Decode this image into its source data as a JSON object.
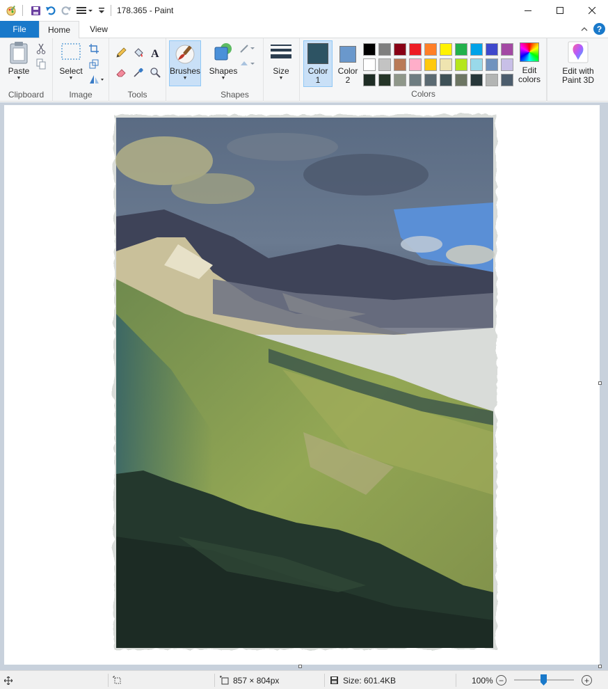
{
  "window": {
    "title": "178.365 - Paint"
  },
  "tabs": {
    "file": "File",
    "home": "Home",
    "view": "View"
  },
  "ribbon": {
    "clipboard": {
      "label": "Clipboard",
      "paste": "Paste"
    },
    "image": {
      "label": "Image",
      "select": "Select"
    },
    "tools": {
      "label": "Tools"
    },
    "brushes": {
      "label": "Brushes"
    },
    "shapes": {
      "label": "Shapes",
      "button": "Shapes"
    },
    "size": {
      "label": "Size"
    },
    "colors": {
      "label": "Colors",
      "color1_line1": "Color",
      "color1_line2": "1",
      "color2_line1": "Color",
      "color2_line2": "2",
      "edit_line1": "Edit",
      "edit_line2": "colors",
      "paint3d_line1": "Edit with",
      "paint3d_line2": "Paint 3D",
      "color1_value": "#2d5363",
      "color2_value": "#6a98cc",
      "palette": [
        "#000000",
        "#7f7f7f",
        "#880015",
        "#ed1c24",
        "#ff7f27",
        "#fff200",
        "#22b14c",
        "#00a2e8",
        "#3f48cc",
        "#a349a4",
        "#ffffff",
        "#c3c3c3",
        "#b97a57",
        "#ffaec9",
        "#ffc90e",
        "#efe4b0",
        "#b5e61d",
        "#99d9ea",
        "#7092be",
        "#c8bfe7",
        "#1e2d25",
        "#253528",
        "#8f978a",
        "#6e7d81",
        "#5b6a72",
        "#3e5157",
        "#6c7563",
        "#28373a",
        "#b3b5b4",
        "#4c5d6d"
      ]
    }
  },
  "statusbar": {
    "dimensions": "857 × 804px",
    "size": "Size: 601.4KB",
    "zoom": "100%",
    "zoom_level": 1.0
  }
}
